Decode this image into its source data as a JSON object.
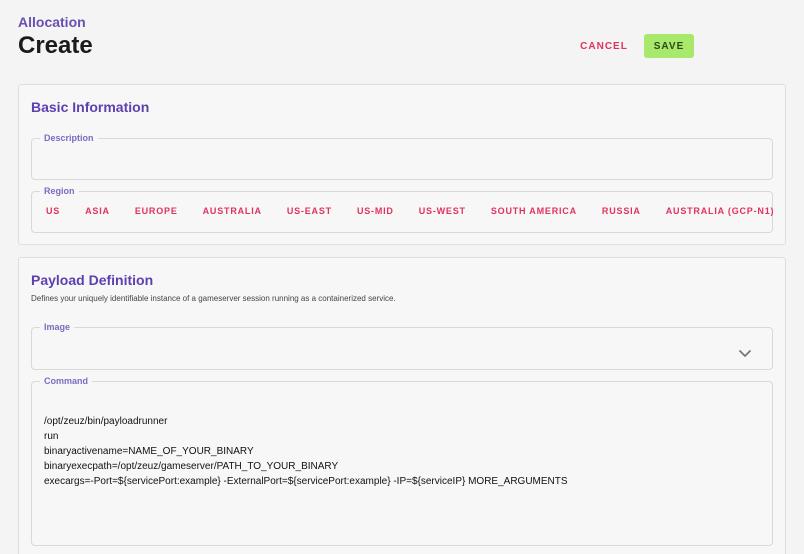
{
  "header": {
    "breadcrumb": "Allocation",
    "title": "Create",
    "cancel_label": "CANCEL",
    "save_label": "SAVE"
  },
  "basic_information": {
    "title": "Basic Information",
    "description": {
      "label": "Description",
      "value": ""
    },
    "region": {
      "label": "Region",
      "options": [
        "US",
        "ASIA",
        "EUROPE",
        "AUSTRALIA",
        "US-EAST",
        "US-MID",
        "US-WEST",
        "SOUTH AMERICA",
        "RUSSIA",
        "AUSTRALIA (GCP-N1)"
      ]
    }
  },
  "payload_definition": {
    "title": "Payload Definition",
    "subtitle": "Defines your uniquely identifiable instance of a gameserver session running as a containerized service.",
    "image": {
      "label": "Image",
      "value": "",
      "icon": "chevron-down-icon"
    },
    "command": {
      "label": "Command",
      "value": "/opt/zeuz/bin/payloadrunner\nrun\nbinaryactivename=NAME_OF_YOUR_BINARY\nbinaryexecpath=/opt/zeuz/gameserver/PATH_TO_YOUR_BINARY\nexecargs=-Port=${servicePort:example} -ExternalPort=${servicePort:example} -IP=${serviceIP} MORE_ARGUMENTS"
    }
  },
  "colors": {
    "accent_purple": "#5e3fb0",
    "accent_pink": "#e0325f",
    "save_green": "#a8e86a"
  }
}
